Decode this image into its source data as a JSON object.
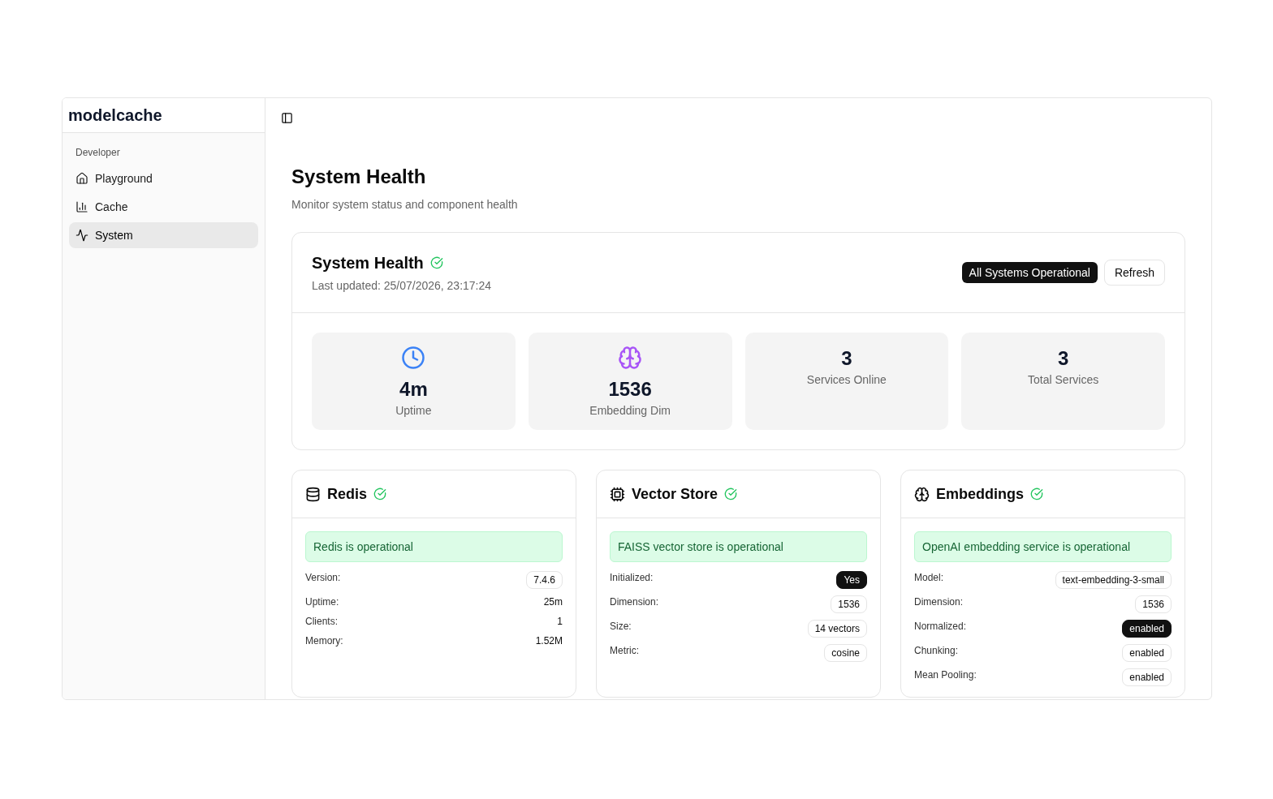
{
  "sidebar": {
    "brand": "modelcache",
    "group_label": "Developer",
    "items": [
      {
        "label": "Playground",
        "selected": false
      },
      {
        "label": "Cache",
        "selected": false
      },
      {
        "label": "System",
        "selected": true
      }
    ]
  },
  "page": {
    "title": "System Health",
    "subtitle": "Monitor system status and component health"
  },
  "overview": {
    "title": "System Health",
    "healthy": true,
    "last_updated": "Last updated: 25/07/2026, 23:17:24",
    "status_badge": "All Systems Operational",
    "refresh_button": "Refresh",
    "stats": [
      {
        "value": "4m",
        "label": "Uptime"
      },
      {
        "value": "1536",
        "label": "Embedding Dim"
      },
      {
        "value": "3",
        "label": "Services Online"
      },
      {
        "value": "3",
        "label": "Total Services"
      }
    ]
  },
  "services": [
    {
      "name": "Redis",
      "healthy": true,
      "message": "Redis is operational",
      "rows": [
        {
          "label": "Version:",
          "value": "7.4.6",
          "kind": "badge"
        },
        {
          "label": "Uptime:",
          "value": "25m",
          "kind": "text"
        },
        {
          "label": "Clients:",
          "value": "1",
          "kind": "text"
        },
        {
          "label": "Memory:",
          "value": "1.52M",
          "kind": "text"
        }
      ]
    },
    {
      "name": "Vector Store",
      "healthy": true,
      "message": "FAISS vector store is operational",
      "rows": [
        {
          "label": "Initialized:",
          "value": "Yes",
          "kind": "filled"
        },
        {
          "label": "Dimension:",
          "value": "1536",
          "kind": "badge"
        },
        {
          "label": "Size:",
          "value": "14 vectors",
          "kind": "badge"
        },
        {
          "label": "Metric:",
          "value": "cosine",
          "kind": "badge"
        }
      ]
    },
    {
      "name": "Embeddings",
      "healthy": true,
      "message": "OpenAI embedding service is operational",
      "rows": [
        {
          "label": "Model:",
          "value": "text-embedding-3-small",
          "kind": "badge"
        },
        {
          "label": "Dimension:",
          "value": "1536",
          "kind": "badge"
        },
        {
          "label": "Normalized:",
          "value": "enabled",
          "kind": "filled"
        },
        {
          "label": "Chunking:",
          "value": "enabled",
          "kind": "badge"
        },
        {
          "label": "Mean Pooling:",
          "value": "enabled",
          "kind": "badge"
        }
      ]
    }
  ]
}
